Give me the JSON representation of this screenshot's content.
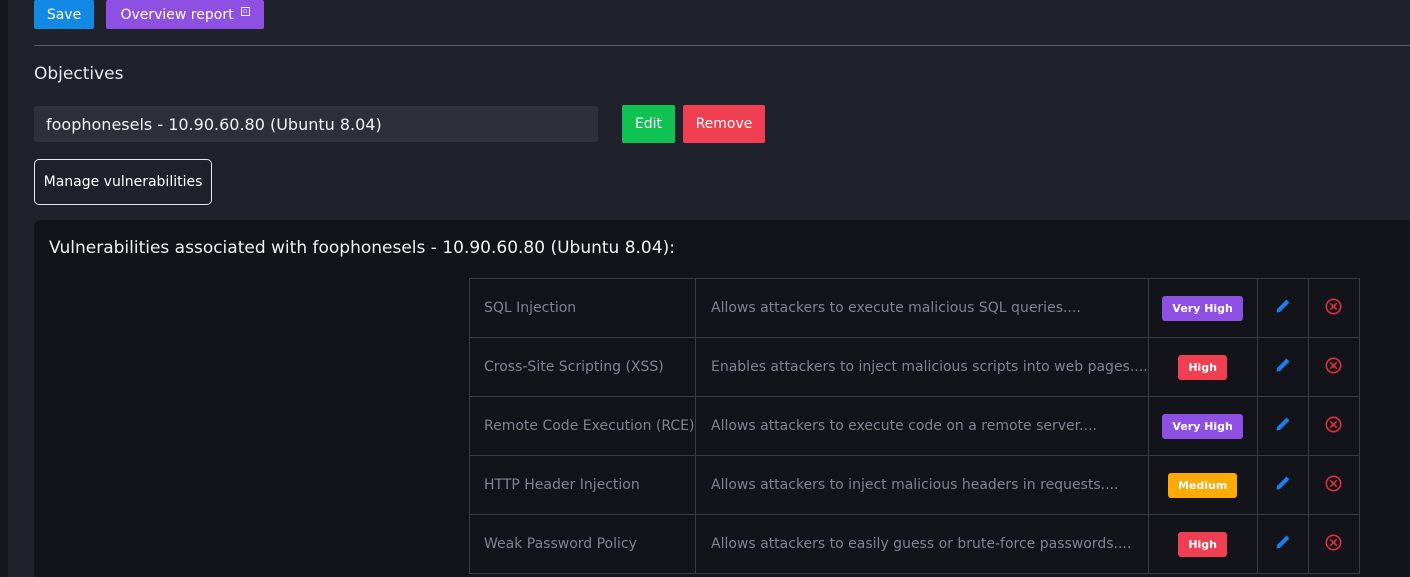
{
  "toolbar": {
    "save_label": "Save",
    "overview_label": "Overview report",
    "overview_icon": "external-link-icon"
  },
  "objectives": {
    "title": "Objectives",
    "current_value": "foophonesels - 10.90.60.80 (Ubuntu 8.04)",
    "edit_label": "Edit",
    "remove_label": "Remove",
    "manage_label": "Manage vulnerabilities"
  },
  "vulnerabilities": {
    "heading": "Vulnerabilities associated with foophonesels - 10.90.60.80 (Ubuntu 8.04):",
    "rows": [
      {
        "name": "SQL Injection",
        "description": "Allows attackers to execute malicious SQL queries....",
        "severity": "Very High",
        "severity_color": "#8e4fe3"
      },
      {
        "name": "Cross-Site Scripting (XSS)",
        "description": "Enables attackers to inject malicious scripts into web pages....",
        "severity": "High",
        "severity_color": "#f03f52"
      },
      {
        "name": "Remote Code Execution (RCE)",
        "description": "Allows attackers to execute code on a remote server....",
        "severity": "Very High",
        "severity_color": "#8e4fe3"
      },
      {
        "name": "HTTP Header Injection",
        "description": "Allows attackers to inject malicious headers in requests....",
        "severity": "Medium",
        "severity_color": "#fcaa07"
      },
      {
        "name": "Weak Password Policy",
        "description": "Allows attackers to easily guess or brute-force passwords....",
        "severity": "High",
        "severity_color": "#f03f52"
      }
    ]
  },
  "colors": {
    "save": "#1389e6",
    "overview": "#8e4fe3",
    "edit": "#0fc252",
    "remove": "#f03f52",
    "edit_icon": "#1f7ce8",
    "delete_icon": "#e0303f"
  }
}
